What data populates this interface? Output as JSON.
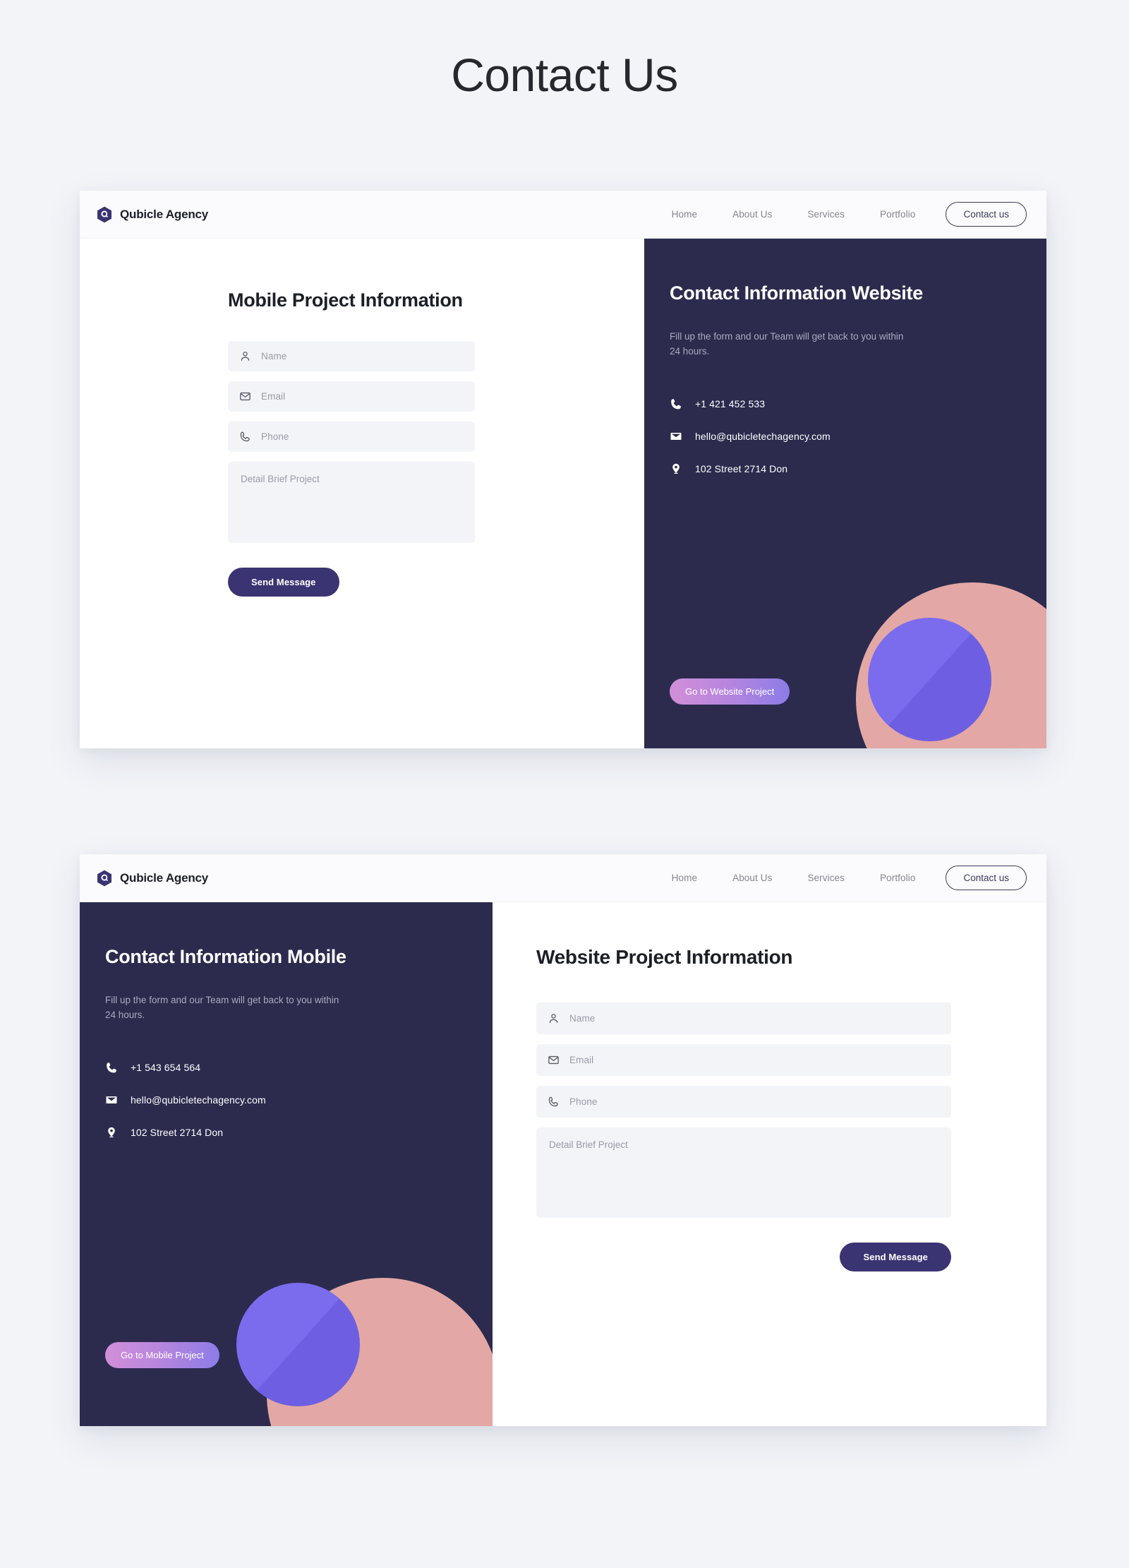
{
  "page": {
    "title": "Contact Us",
    "background_color": "#f2f4f8"
  },
  "colors": {
    "dark_panel": "#2c2b4e",
    "button_primary": "#3b3472",
    "gradient_start": "#d28fd8",
    "gradient_end": "#8b7ce8",
    "blob_pink": "#e3a8a5",
    "blob_purple": "#7363ec",
    "field_background": "#f3f4f8"
  },
  "brand": {
    "name": "Qubicle Agency",
    "logo_icon": "hexagon-q-icon"
  },
  "nav": {
    "links": [
      {
        "label": "Home"
      },
      {
        "label": "About Us"
      },
      {
        "label": "Services"
      },
      {
        "label": "Portfolio"
      }
    ],
    "cta_label": "Contact us"
  },
  "form_fields": {
    "name": {
      "placeholder": "Name",
      "icon": "person-icon",
      "value": ""
    },
    "email": {
      "placeholder": "Email",
      "icon": "envelope-icon",
      "value": ""
    },
    "phone": {
      "placeholder": "Phone",
      "icon": "phone-icon",
      "value": ""
    },
    "detail": {
      "placeholder": "Detail Brief Project",
      "value": ""
    },
    "submit_label": "Send Message"
  },
  "card_website": {
    "form_title": "Mobile Project Information",
    "info_title": "Contact Information Website",
    "info_subtitle": "Fill up the form and our Team will get back to you within 24 hours.",
    "contacts": [
      {
        "icon": "phone-icon",
        "text": "+1 421 452 533"
      },
      {
        "icon": "envelope-icon",
        "text": "hello@qubicletechagency.com"
      },
      {
        "icon": "location-pin-icon",
        "text": "102 Street 2714 Don"
      }
    ],
    "goto_label": "Go to Website Project"
  },
  "card_mobile": {
    "form_title": "Website Project Information",
    "info_title": "Contact Information Mobile",
    "info_subtitle": "Fill up the form and our Team will get back to you within 24 hours.",
    "contacts": [
      {
        "icon": "phone-icon",
        "text": "+1 543 654 564"
      },
      {
        "icon": "envelope-icon",
        "text": "hello@qubicletechagency.com"
      },
      {
        "icon": "location-pin-icon",
        "text": "102 Street 2714 Don"
      }
    ],
    "goto_label": "Go to Mobile Project"
  }
}
